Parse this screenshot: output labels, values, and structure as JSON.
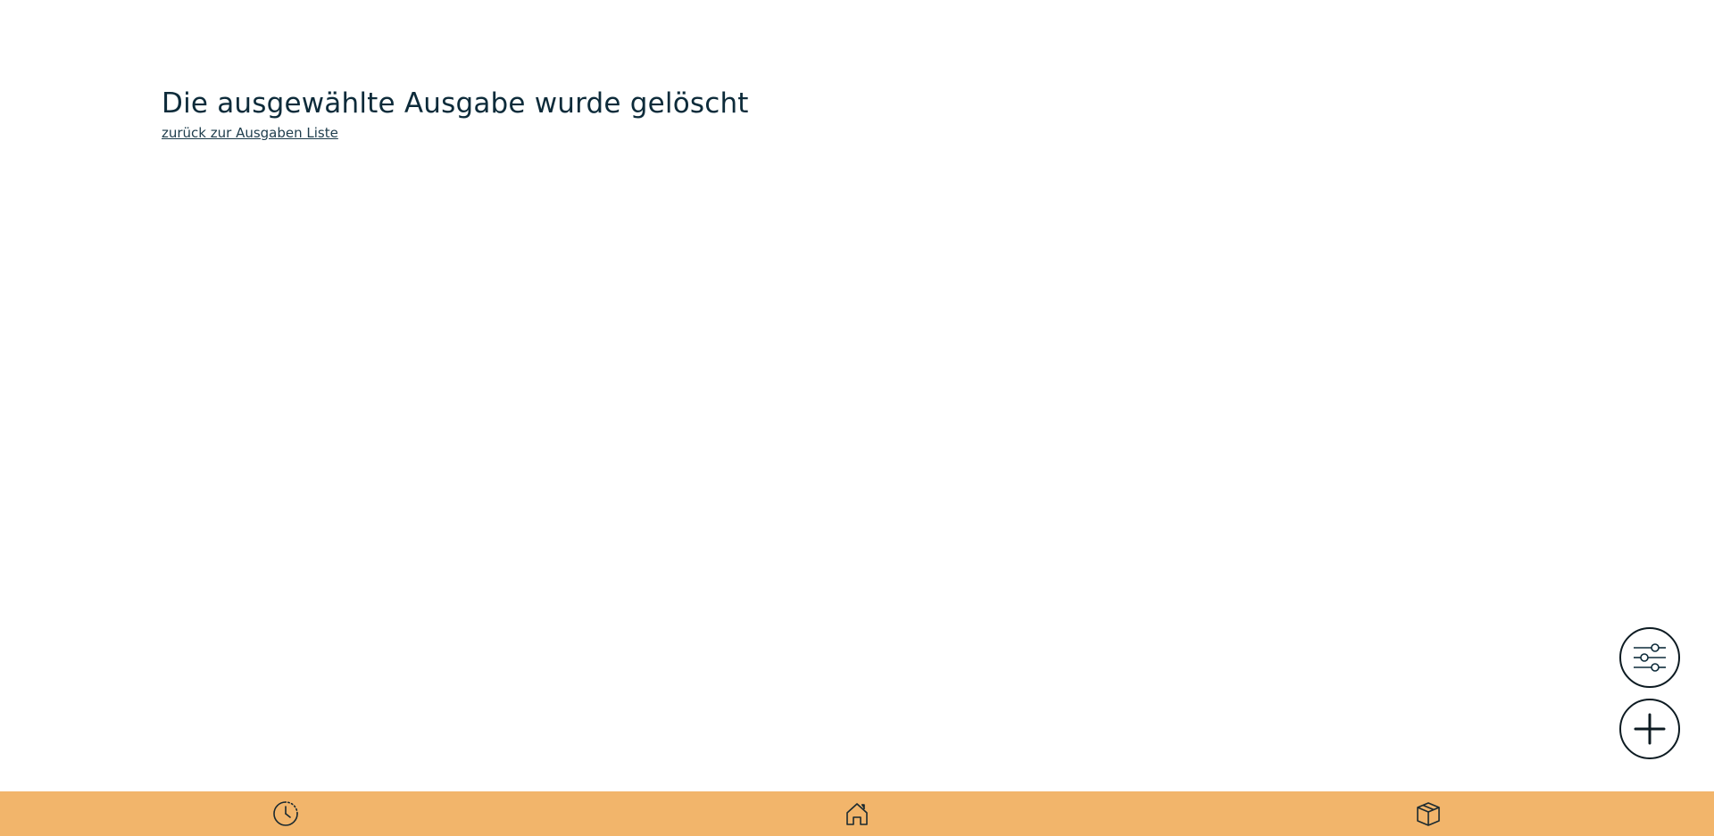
{
  "main": {
    "title": "Die ausgewählte Ausgabe wurde gelöscht",
    "back_link": "zurück zur Ausgaben Liste"
  },
  "fabs": [
    {
      "icon": "sliders-icon"
    },
    {
      "icon": "plus-icon"
    }
  ],
  "bottom_nav": {
    "background": "#f2b56b",
    "items": [
      {
        "icon": "history-icon"
      },
      {
        "icon": "home-icon"
      },
      {
        "icon": "box-icon"
      }
    ]
  },
  "colors": {
    "text": "#0d2b3a",
    "accent": "#f2b56b",
    "background": "#ffffff"
  }
}
